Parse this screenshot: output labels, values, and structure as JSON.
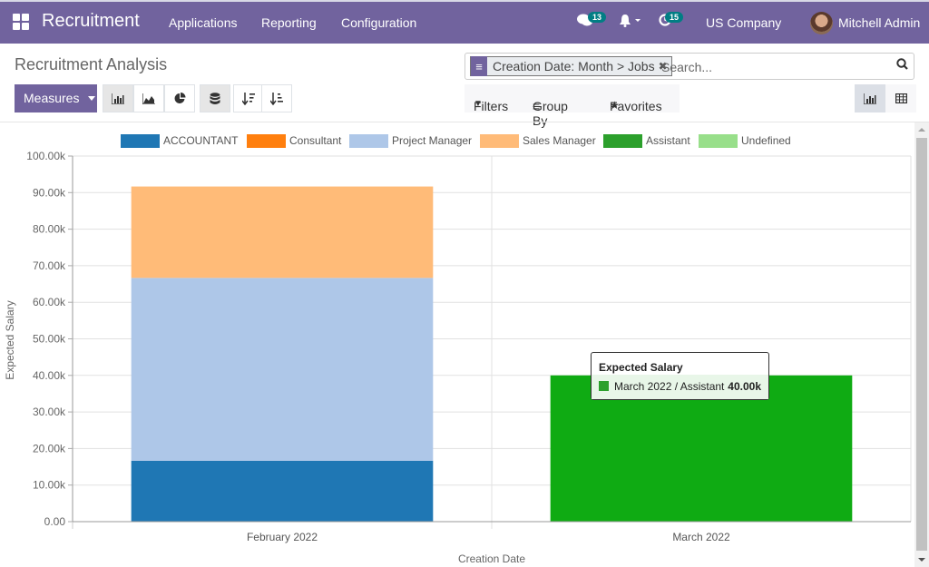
{
  "navbar": {
    "brand": "Recruitment",
    "menus": [
      "Applications",
      "Reporting",
      "Configuration"
    ],
    "messages_count": "13",
    "activities_count": "15",
    "company": "US Company",
    "user": "Mitchell Admin",
    "icons": [
      "apps-icon",
      "chat-icon",
      "bell-icon",
      "clock-icon"
    ]
  },
  "page": {
    "title": "Recruitment Analysis",
    "measures_label": "Measures"
  },
  "search": {
    "facet_label": "Creation Date: Month > Jobs",
    "placeholder": "Search...",
    "filters_label": "Filters",
    "groupby_label": "Group By",
    "favorites_label": "Favorites"
  },
  "tooltip": {
    "title": "Expected Salary",
    "label": "March 2022 / Assistant",
    "value": "40.00k",
    "color": "#2ca02c"
  },
  "chart_data": {
    "type": "bar",
    "stacked": true,
    "title": "",
    "xlabel": "Creation Date",
    "ylabel": "Expected Salary",
    "ylim": [
      0,
      100000
    ],
    "yticks": [
      "0.00",
      "10.00k",
      "20.00k",
      "30.00k",
      "40.00k",
      "50.00k",
      "60.00k",
      "70.00k",
      "80.00k",
      "90.00k",
      "100.00k"
    ],
    "grid": true,
    "legend_position": "top",
    "categories": [
      "February 2022",
      "March 2022"
    ],
    "series": [
      {
        "name": "ACCOUNTANT",
        "color": "#1f77b4",
        "values": [
          16667,
          0
        ]
      },
      {
        "name": "Consultant",
        "color": "#ff7f0e",
        "values": [
          0,
          0
        ]
      },
      {
        "name": "Project Manager",
        "color": "#aec7e8",
        "values": [
          50000,
          0
        ]
      },
      {
        "name": "Sales Manager",
        "color": "#ffbb78",
        "values": [
          25000,
          0
        ]
      },
      {
        "name": "Assistant",
        "color": "#2ca02c",
        "values": [
          0,
          40000
        ]
      },
      {
        "name": "Undefined",
        "color": "#98df8a",
        "values": [
          0,
          0
        ]
      }
    ],
    "highlighted": {
      "category": "March 2022",
      "series": "Assistant",
      "color": "#0fab13"
    }
  }
}
